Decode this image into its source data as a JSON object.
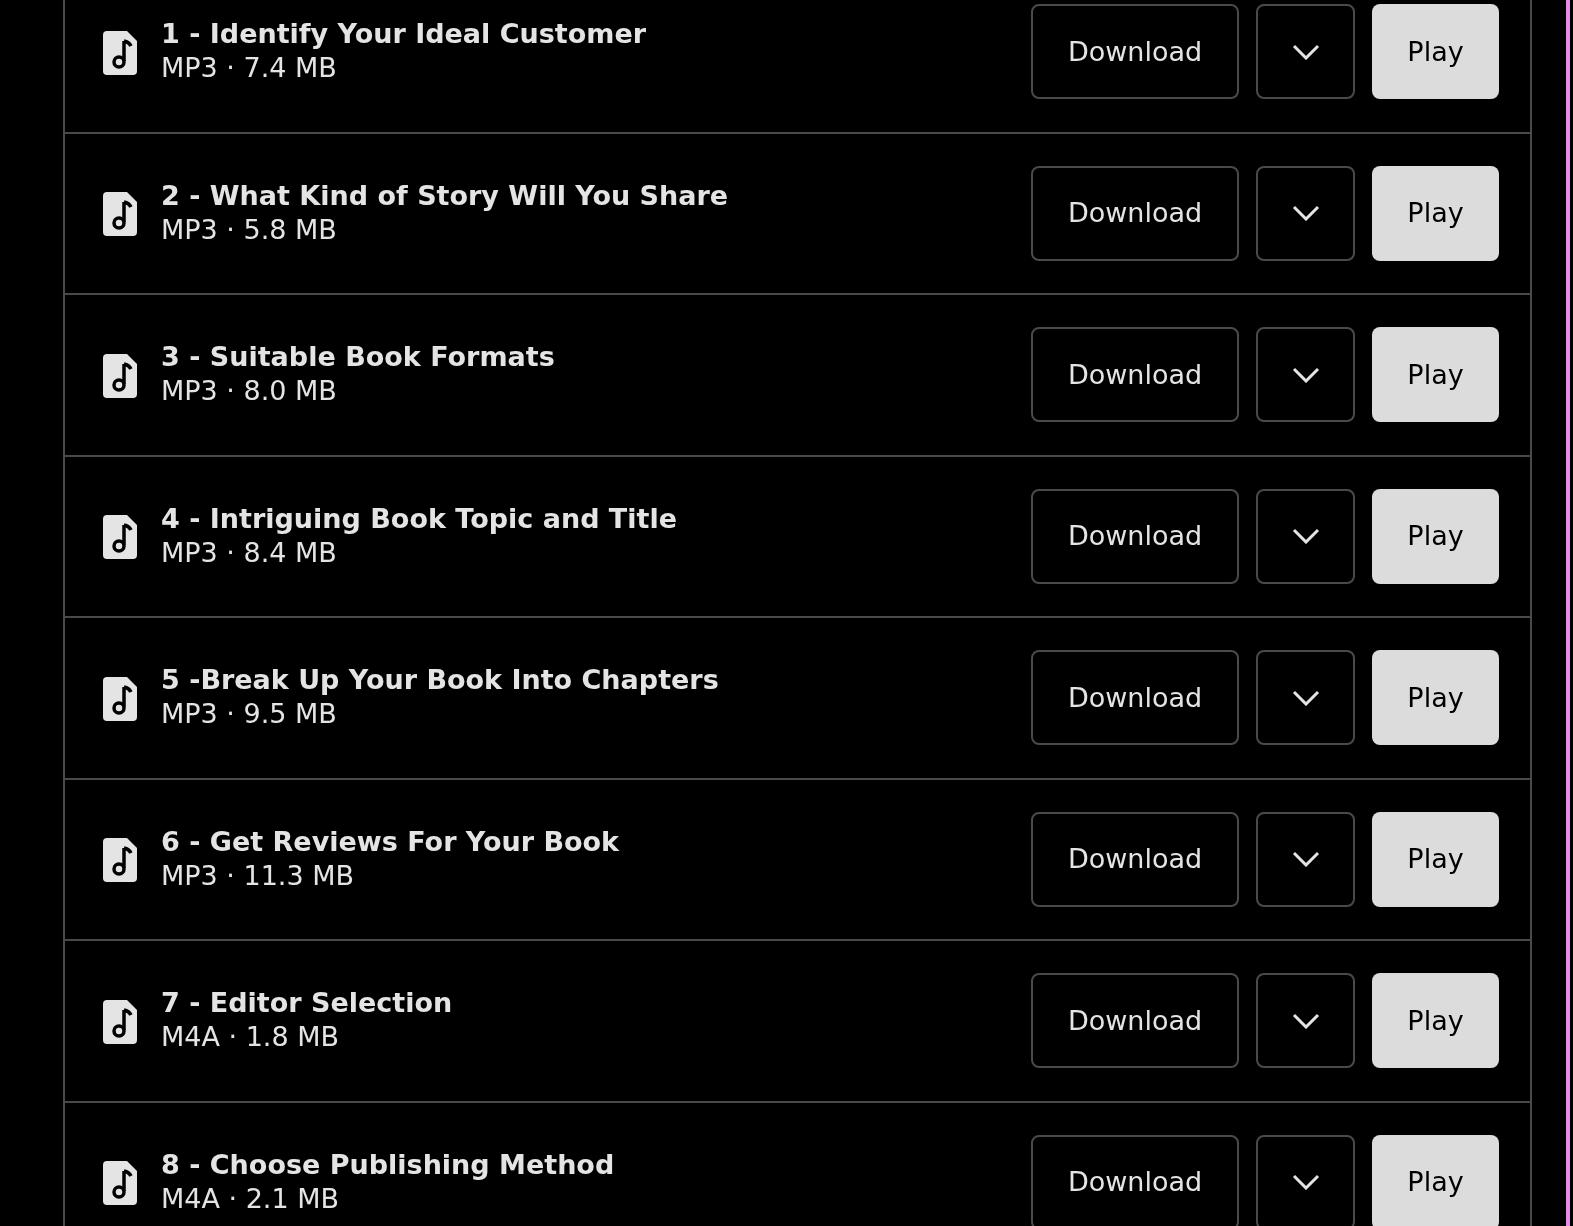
{
  "tracks": [
    {
      "title": "1 - Identify Your Ideal Customer",
      "meta": "MP3 · 7.4 MB",
      "download": "Download",
      "play": "Play"
    },
    {
      "title": "2 - What Kind of Story Will You Share",
      "meta": "MP3 · 5.8 MB",
      "download": "Download",
      "play": "Play"
    },
    {
      "title": "3 - Suitable Book Formats",
      "meta": "MP3 · 8.0 MB",
      "download": "Download",
      "play": "Play"
    },
    {
      "title": "4 - Intriguing Book Topic and Title",
      "meta": "MP3 · 8.4 MB",
      "download": "Download",
      "play": "Play"
    },
    {
      "title": "5 -Break Up Your Book Into Chapters",
      "meta": "MP3 · 9.5 MB",
      "download": "Download",
      "play": "Play"
    },
    {
      "title": "6 - Get Reviews For Your Book",
      "meta": "MP3 · 11.3 MB",
      "download": "Download",
      "play": "Play"
    },
    {
      "title": "7 - Editor Selection",
      "meta": "M4A · 1.8 MB",
      "download": "Download",
      "play": "Play"
    },
    {
      "title": "8 - Choose Publishing Method",
      "meta": "M4A · 2.1 MB",
      "download": "Download",
      "play": "Play"
    }
  ]
}
